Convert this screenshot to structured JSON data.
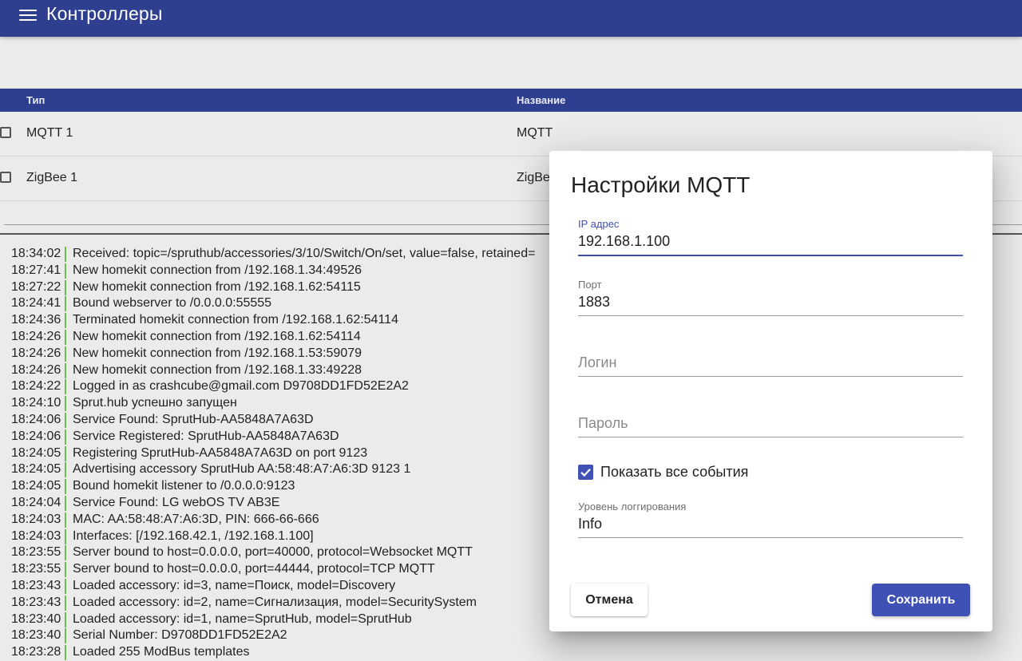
{
  "app": {
    "title": "Контроллеры",
    "menu_icon": "menu-icon"
  },
  "table": {
    "columns": [
      "Тип",
      "Название"
    ],
    "rows": [
      {
        "type": "MQTT 1",
        "name": "MQTT"
      },
      {
        "type": "ZigBee 1",
        "name": "ZigBee"
      }
    ]
  },
  "log": [
    {
      "time": "18:34:02",
      "msg": "Received: topic=/spruthub/accessories/3/10/Switch/On/set, value=false, retained="
    },
    {
      "time": "18:27:41",
      "msg": "New homekit connection from /192.168.1.34:49526"
    },
    {
      "time": "18:27:22",
      "msg": "New homekit connection from /192.168.1.62:54115"
    },
    {
      "time": "18:24:41",
      "msg": "Bound webserver to /0.0.0.0:55555"
    },
    {
      "time": "18:24:36",
      "msg": "Terminated homekit connection from /192.168.1.62:54114"
    },
    {
      "time": "18:24:26",
      "msg": "New homekit connection from /192.168.1.62:54114"
    },
    {
      "time": "18:24:26",
      "msg": "New homekit connection from /192.168.1.53:59079"
    },
    {
      "time": "18:24:26",
      "msg": "New homekit connection from /192.168.1.33:49228"
    },
    {
      "time": "18:24:22",
      "msg": "Logged in as crashcube@gmail.com D9708DD1FD52E2A2"
    },
    {
      "time": "18:24:10",
      "msg": "Sprut.hub успешно запущен"
    },
    {
      "time": "18:24:06",
      "msg": "Service Found: SprutHub-AA5848A7A63D"
    },
    {
      "time": "18:24:06",
      "msg": "Service Registered: SprutHub-AA5848A7A63D"
    },
    {
      "time": "18:24:05",
      "msg": "Registering SprutHub-AA5848A7A63D on port 9123"
    },
    {
      "time": "18:24:05",
      "msg": "Advertising accessory SprutHub AA:58:48:A7:A6:3D 9123 1"
    },
    {
      "time": "18:24:05",
      "msg": "Bound homekit listener to /0.0.0.0:9123"
    },
    {
      "time": "18:24:04",
      "msg": "Service Found: LG webOS TV AB3E"
    },
    {
      "time": "18:24:03",
      "msg": "MAC: AA:58:48:A7:A6:3D, PIN: 666-66-666"
    },
    {
      "time": "18:24:03",
      "msg": "Interfaces: [/192.168.42.1, /192.168.1.100]"
    },
    {
      "time": "18:23:55",
      "msg": "Server bound to host=0.0.0.0, port=40000, protocol=Websocket MQTT"
    },
    {
      "time": "18:23:55",
      "msg": "Server bound to host=0.0.0.0, port=44444, protocol=TCP MQTT"
    },
    {
      "time": "18:23:43",
      "msg": "Loaded accessory: id=3, name=Поиск, model=Discovery"
    },
    {
      "time": "18:23:43",
      "msg": "Loaded accessory: id=2, name=Сигнализация, model=SecuritySystem"
    },
    {
      "time": "18:23:40",
      "msg": "Loaded accessory: id=1, name=SprutHub, model=SprutHub"
    },
    {
      "time": "18:23:40",
      "msg": "Serial Number: D9708DD1FD52E2A2"
    },
    {
      "time": "18:23:28",
      "msg": "Loaded 255 ModBus templates"
    }
  ],
  "dialog": {
    "title": "Настройки MQTT",
    "ip": {
      "label": "IP адрес",
      "value": "192.168.1.100"
    },
    "port": {
      "label": "Порт",
      "value": "1883"
    },
    "login": {
      "placeholder": "Логин",
      "value": ""
    },
    "password": {
      "placeholder": "Пароль",
      "value": ""
    },
    "show_all_events": {
      "label": "Показать все события",
      "checked": true
    },
    "log_level": {
      "label": "Уровень логгирования",
      "value": "Info"
    },
    "cancel_label": "Отмена",
    "save_label": "Сохранить"
  },
  "colors": {
    "primary": "#2f3f8f",
    "accent": "#3f51b5",
    "log_marker": "#6cbf4f"
  }
}
